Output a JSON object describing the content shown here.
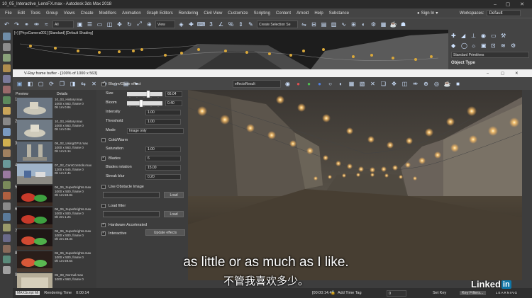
{
  "window": {
    "title": "10_05_Interactive_LensFX.max - Autodesk 3ds Max 2018"
  },
  "menu": [
    "File",
    "Edit",
    "Tools",
    "Group",
    "Views",
    "Create",
    "Modifiers",
    "Animation",
    "Graph Editors",
    "Rendering",
    "Civil View",
    "Customize",
    "Scripting",
    "Content",
    "Arnold",
    "Help",
    "Substance"
  ],
  "account": {
    "signin": "Sign In",
    "workspaces_label": "Workspaces:",
    "workspace": "Default"
  },
  "toolbar": {
    "filter": "All",
    "view": "View",
    "selection_set": "Create Selection Se"
  },
  "viewport": {
    "label": "[+] [PhysCamera001] [Standard] [Default Shading]"
  },
  "command_panel": {
    "primitives": "Standard Primitives",
    "object_type": "Object Type"
  },
  "frame_buffer": {
    "title": "V-Ray frame buffer - [100% of 1000 x 563]",
    "channel": "effectsResult",
    "columns": {
      "preview": "Preview",
      "details": "Details"
    },
    "history": [
      {
        "num": "1",
        "name": "10_03_History.max",
        "size": "1000 x 563, frame 0",
        "time": "0h 1m 0.8s"
      },
      {
        "num": "2",
        "name": "10_03_History.max",
        "size": "1000 x 563, frame 0",
        "time": "0h 1m 0.9s"
      },
      {
        "num": "3",
        "name": "08_02_UsingGPU.max",
        "size": "1000 x 563, frame 0",
        "time": "0h 1m 5.1s"
      },
      {
        "num": "4",
        "name": "07_02_CamControls.max",
        "size": "1200 x 545, frame 0",
        "time": "0h 1m 2.4s"
      },
      {
        "num": "5",
        "name": "06_06_Superbrights.max",
        "size": "1000 x 500, frame 0",
        "time": "0h 1m 59.8s"
      },
      {
        "num": "6",
        "name": "06_06_Superbrights.max",
        "size": "1000 x 500, frame 0",
        "time": "0h 2m 1.2s"
      },
      {
        "num": "7",
        "name": "06_06_Superbrights.max",
        "size": "1000 x 500, frame 0",
        "time": "0h 2m 38.3s"
      },
      {
        "num": "8",
        "name": "06_06_Superbrights.max",
        "size": "1000 x 500, frame 0",
        "time": "0h 1m 59.5s"
      },
      {
        "num": "9",
        "name": "05_08_Normal.max",
        "size": "1000 x 563, frame 0",
        "time": ""
      }
    ],
    "settings": {
      "bloom_glare": "Bloom/Glare effect",
      "size_label": "Size",
      "size_value": "66.04",
      "bloom_label": "Bloom",
      "bloom_value": "0.40",
      "intensity_label": "Intensity",
      "intensity_value": "1.00",
      "threshold_label": "Threshold",
      "threshold_value": "1.00",
      "mode_label": "Mode",
      "mode_value": "Image only",
      "cold_warm": "Cold/Warm",
      "saturation_label": "Saturation",
      "saturation_value": "1.00",
      "blades_label": "Blades",
      "blades_value": "6",
      "blades_rotation_label": "Blades rotation",
      "blades_rotation_value": "15.00",
      "streak_blur_label": "Streak blur",
      "streak_blur_value": "0.20",
      "use_obstacle": "Use Obstacle Image",
      "load1": "Load",
      "load_filter": "Load filter",
      "load2": "Load",
      "hw_accel": "Hardware Accelerated",
      "interactive": "Interactive",
      "update_effects": "Update effects"
    },
    "status": {
      "rendering_time": "Rendering Time",
      "rendering_value": "0:00:14",
      "render_time_readout": "[00:00:14.4]"
    }
  },
  "timeline": {
    "add_time_tag": "Add Time Tag",
    "set_key": "Set Key",
    "key_filters": "Key Filters...",
    "frame": "0"
  },
  "caption": {
    "english": "as little or as much as I like.",
    "chinese": "不管我喜欢多少。"
  },
  "branding": {
    "linked": "Linked",
    "in": "in",
    "learning": "LEARNING"
  },
  "maxscript": "MAXScript Mi"
}
